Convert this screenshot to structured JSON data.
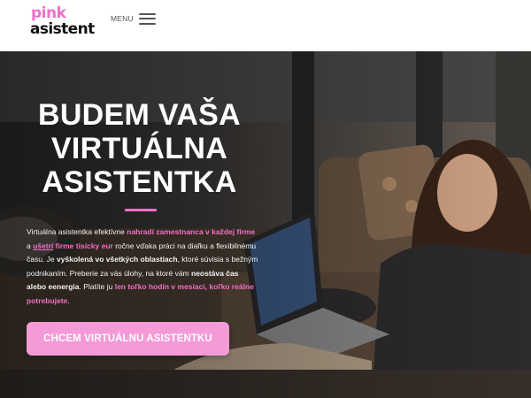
{
  "brand": {
    "logo_line1": "pink",
    "logo_line2": "asistent",
    "accent_color": "#f26fc6"
  },
  "nav": {
    "menu_label": "MENU",
    "menu_icon": "hamburger-icon"
  },
  "hero": {
    "title_lines": [
      "BUDEM VAŠA",
      "VIRTUÁLNA",
      "ASISTENTKA"
    ],
    "text_segments": [
      {
        "text": "Virtuálna asistentka efektívne ",
        "style": "normal"
      },
      {
        "text": "nahradí zamestnanca v každej firme",
        "style": "pink"
      },
      {
        "text": " a ",
        "style": "normal"
      },
      {
        "text": "ušetrí",
        "style": "pink-underline"
      },
      {
        "text": " ",
        "style": "normal"
      },
      {
        "text": "firme tisícky eur",
        "style": "pink"
      },
      {
        "text": " ročne vďaka práci na diaľku a flexibilnému času. Je ",
        "style": "normal"
      },
      {
        "text": "vyškolená vo všetkých oblastiach",
        "style": "bold"
      },
      {
        "text": ", ktoré súvisia s bežným podnikaním. Preberie za vás úlohy, na ktoré vám ",
        "style": "normal"
      },
      {
        "text": "neostáva čas alebo eenergia",
        "style": "bold"
      },
      {
        "text": ". Platíte ju ",
        "style": "normal"
      },
      {
        "text": "len toľko hodín v mesiaci, koľko reálne potrebujete",
        "style": "pink"
      },
      {
        "text": ".",
        "style": "normal"
      }
    ],
    "cta_label": "CHCEM VIRTUÁLNU ASISTENTKU",
    "cta_color": "#f49ad6",
    "background_image": "woman-with-laptop-on-sofa"
  }
}
